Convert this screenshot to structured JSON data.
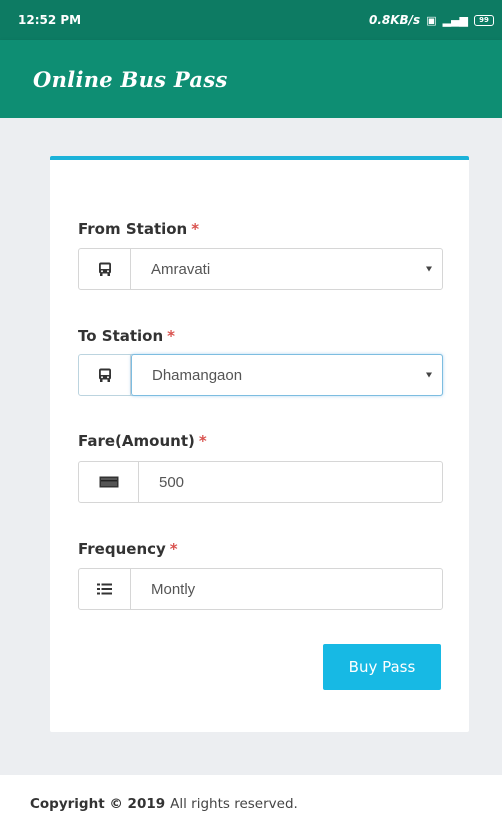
{
  "status_bar": {
    "time": "12:52 PM",
    "network_speed": "0.8KB/s",
    "battery": "99"
  },
  "app_bar": {
    "title": "Online Bus Pass"
  },
  "form": {
    "from_station": {
      "label": "From Station",
      "required_mark": "*",
      "icon": "bus-icon",
      "value": "Amravati"
    },
    "to_station": {
      "label": "To Station",
      "required_mark": "*",
      "icon": "bus-icon",
      "value": "Dhamangaon"
    },
    "fare": {
      "label": "Fare(Amount)",
      "required_mark": "*",
      "icon": "money-icon",
      "value": "500"
    },
    "frequency": {
      "label": "Frequency",
      "required_mark": "*",
      "icon": "list-icon",
      "value": "Montly"
    },
    "submit_label": "Buy Pass"
  },
  "footer": {
    "copyright_strong": "Copyright © 2019",
    "copyright_rest": "All rights reserved."
  },
  "colors": {
    "app_bar": "#0e8e73",
    "status_bar": "#0d7b63",
    "accent": "#1bb2d9",
    "button": "#17b9e4",
    "required": "#d9534f"
  }
}
